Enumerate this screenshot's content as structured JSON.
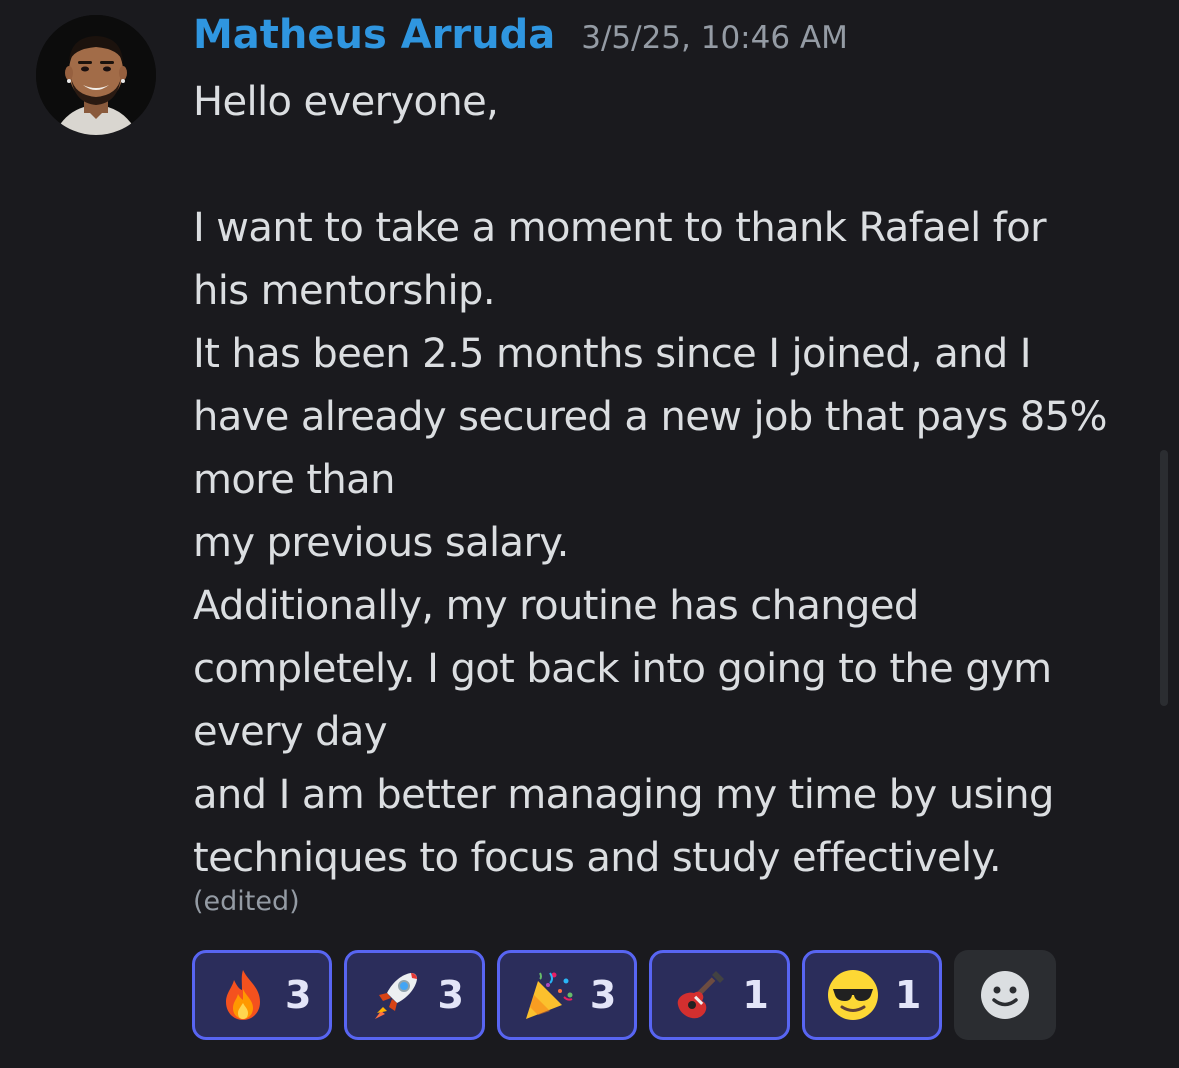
{
  "message": {
    "author": "Matheus Arruda",
    "timestamp": "3/5/25, 10:46 AM",
    "lines": [
      "Hello everyone,",
      "",
      "I want to take a moment to thank Rafael for",
      "his mentorship.",
      "It has been 2.5 months since I joined, and I",
      "have already secured a new job that pays 85%",
      "more than",
      "my previous salary.",
      "Additionally, my routine has changed",
      "completely. I got back into going to the gym",
      "every day",
      "and I am better managing my time by using",
      "techniques to focus and study effectively."
    ],
    "edited_label": "(edited)"
  },
  "reactions": [
    {
      "emoji": "fire-emoji",
      "count": "3"
    },
    {
      "emoji": "rocket-emoji",
      "count": "3"
    },
    {
      "emoji": "party-popper-emoji",
      "count": "3"
    },
    {
      "emoji": "guitar-emoji",
      "count": "1"
    },
    {
      "emoji": "sunglasses-face-emoji",
      "count": "1"
    }
  ],
  "add_reaction_icon": "smiley-add-reaction-icon",
  "colors": {
    "background": "#1a1a1e",
    "username": "#2f96e0",
    "text": "#dbdee1",
    "muted": "#949ba4",
    "reaction_border": "#5865f2",
    "reaction_bg": "#2b2d5b"
  }
}
